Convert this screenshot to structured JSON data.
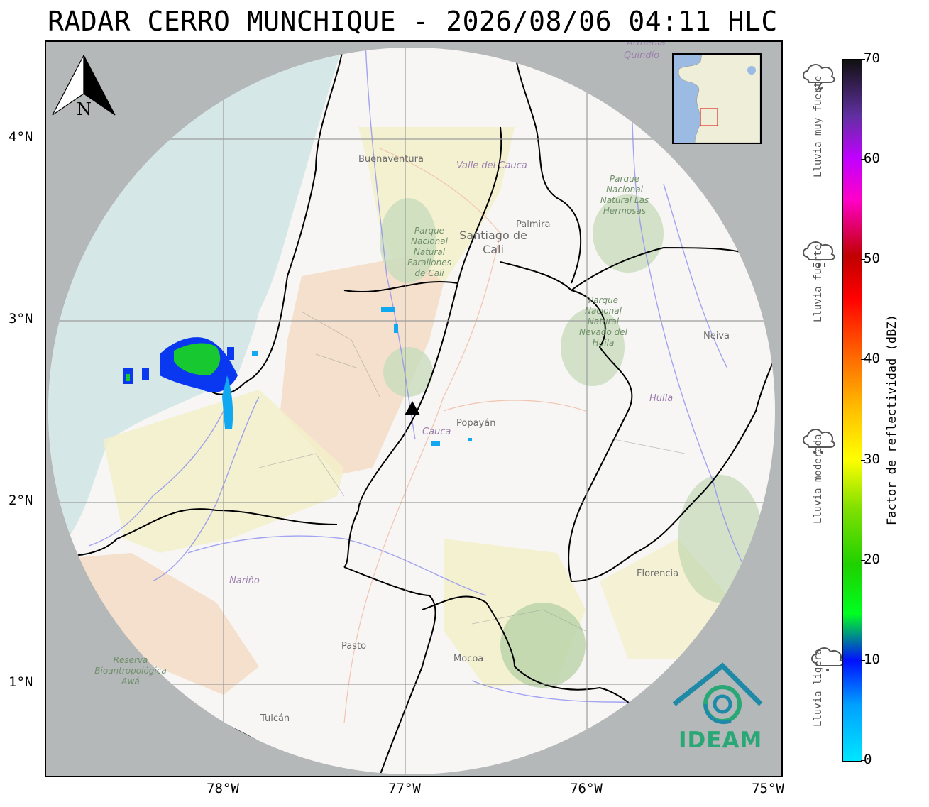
{
  "title": "RADAR CERRO MUNCHIQUE - 2026/08/06 04:11 HLC",
  "lat_ticks": [
    "4°N",
    "3°N",
    "2°N",
    "1°N"
  ],
  "lon_ticks": [
    "78°W",
    "77°W",
    "76°W",
    "75°W"
  ],
  "north_label": "N",
  "cities": {
    "buenaventura": "Buenaventura",
    "santiago_de_cali": "Santiago de Cali",
    "palmira": "Palmira",
    "neiva": "Neiva",
    "popayan": "Popayán",
    "florencia": "Florencia",
    "pasto": "Pasto",
    "mocoa": "Mocoa",
    "tulcan": "Tulcán"
  },
  "regions": {
    "valle_del_cauca": "Valle del Cauca",
    "cauca": "Cauca",
    "huila": "Huila",
    "narino": "Nariño",
    "quindio": "Quindío",
    "armenia": "Armenia"
  },
  "parks": {
    "farallones": "Parque Nacional Natural Farallones de Cali",
    "las_hermosas": "Parque Nacional Natural Las Hermosas",
    "nevado_del_huila": "Parque Nacional Natural Nevado del Huila",
    "awa": "Reserva Bioantropológica Awá"
  },
  "logo_text": "IDEAM",
  "rain_categories": [
    "Lluvia muy fuerte",
    "Lluvia fuerte",
    "Lluvia moderada",
    "Lluvia ligera"
  ],
  "colorbar": {
    "label": "Factor de reflectividad (dBZ)",
    "min": 0,
    "max": 70,
    "ticks": [
      "70",
      "60",
      "50",
      "40",
      "30",
      "20",
      "10",
      "0"
    ]
  },
  "colors": {
    "radar_mask": "#b4b8b8",
    "radar_coverage": "#f7f6f4",
    "ocean": "#d6e7e8",
    "department_border": "#000000",
    "logo": "#2aa776",
    "radar_site": "#000000"
  }
}
